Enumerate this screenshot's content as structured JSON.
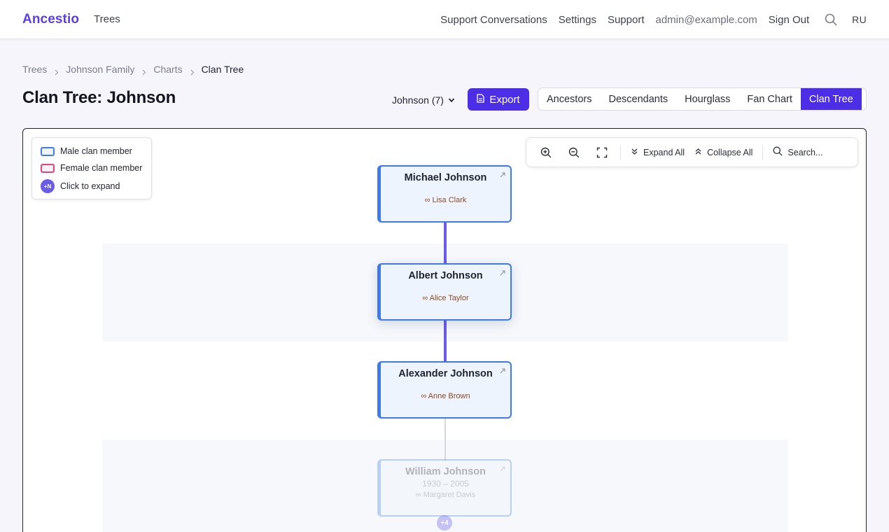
{
  "header": {
    "brand": "Ancestio",
    "nav_trees": "Trees",
    "links": {
      "support_conversations": "Support Conversations",
      "settings": "Settings",
      "support": "Support",
      "email": "admin@example.com",
      "sign_out": "Sign Out",
      "lang": "RU"
    },
    "icons": {
      "search": "search-icon"
    }
  },
  "breadcrumb": {
    "items": [
      "Trees",
      "Johnson Family",
      "Charts"
    ],
    "current": "Clan Tree"
  },
  "title": "Clan Tree: Johnson",
  "clan_select": {
    "value": "Johnson (7)"
  },
  "export_label": "Export",
  "view_tabs": [
    {
      "label": "Ancestors",
      "active": false
    },
    {
      "label": "Descendants",
      "active": false
    },
    {
      "label": "Hourglass",
      "active": false
    },
    {
      "label": "Fan Chart",
      "active": false
    },
    {
      "label": "Clan Tree",
      "active": true
    }
  ],
  "legend": {
    "male": "Male clan member",
    "female": "Female clan member",
    "expand": "Click to expand",
    "expand_badge": "+N"
  },
  "toolbar": {
    "expand_all": "Expand All",
    "collapse_all": "Collapse All",
    "search": "Search..."
  },
  "tree": {
    "nodes": [
      {
        "name": "Michael Johnson",
        "spouse": "∞ Lisa Clark"
      },
      {
        "name": "Albert Johnson",
        "spouse": "∞ Alice Taylor"
      },
      {
        "name": "Alexander Johnson",
        "spouse": "∞ Anne Brown"
      },
      {
        "name": "William Johnson",
        "dates": "1930 – 2005",
        "spouse": "∞ Margaret Davis"
      }
    ],
    "collapsed_badge": "+4"
  },
  "colors": {
    "brand": "#5b3ee6",
    "primary": "#4b2ee6",
    "male_border": "#3f7ae8",
    "female_border": "#e0457b",
    "connector": "#6a5ce8"
  }
}
